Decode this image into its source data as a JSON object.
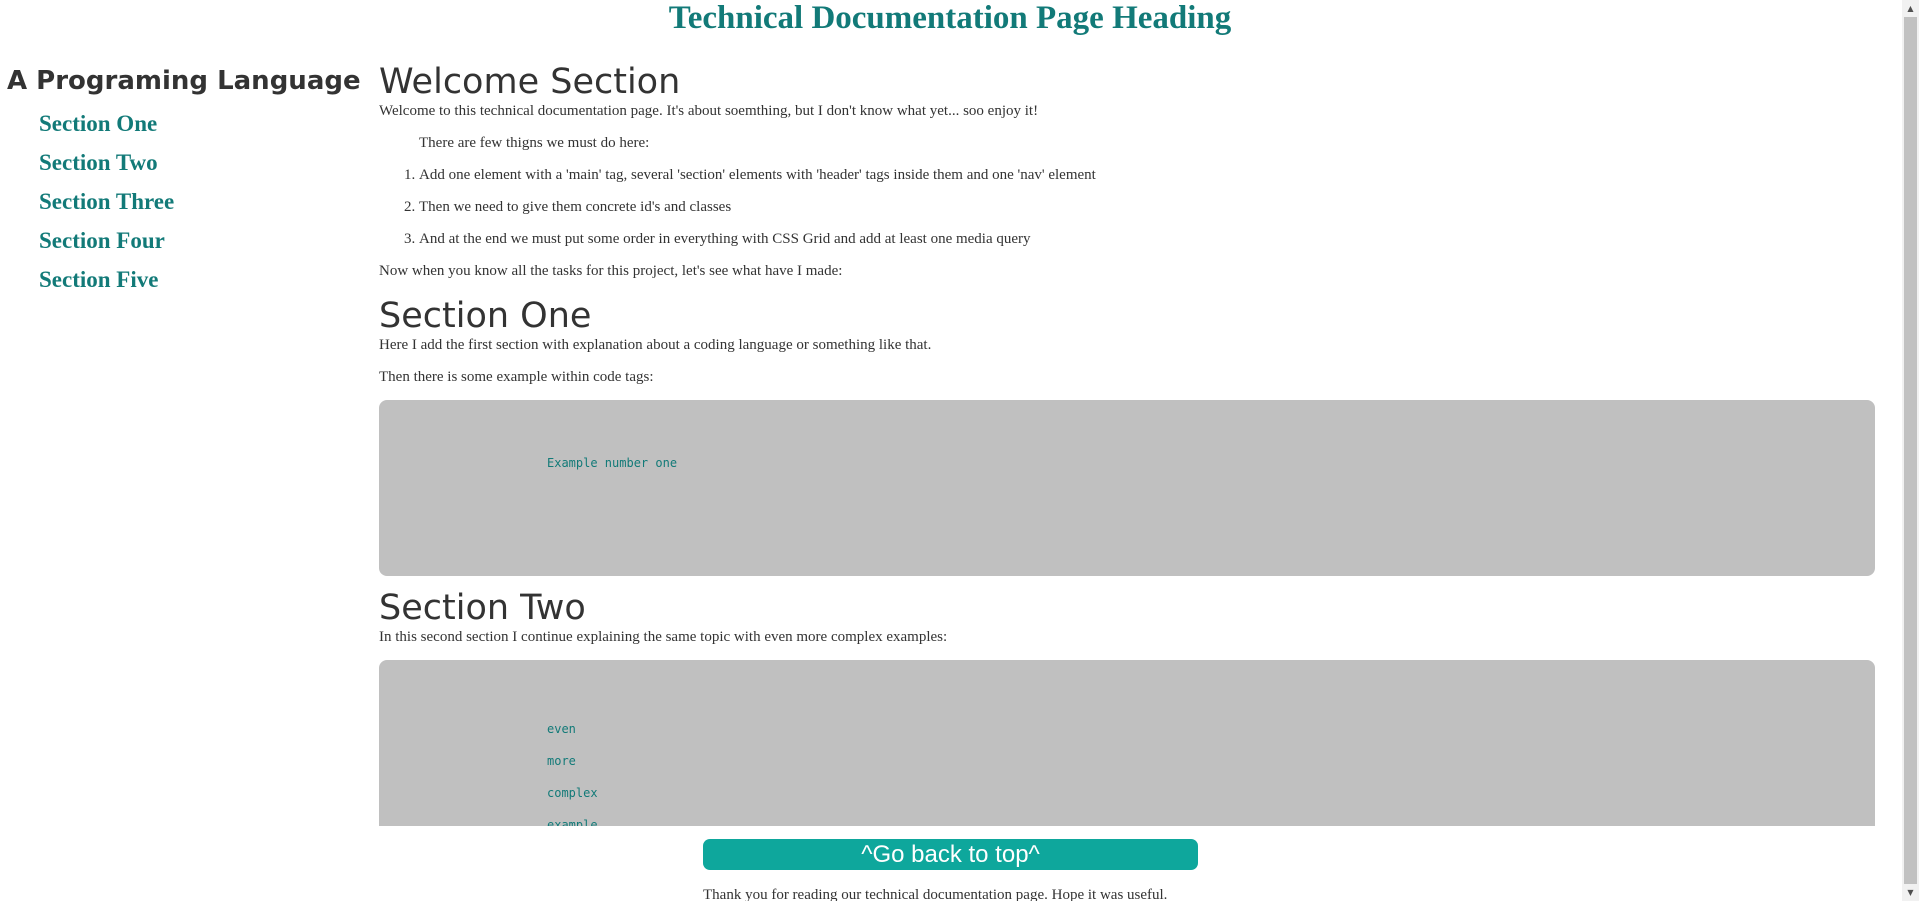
{
  "header": {
    "title": "Technical Documentation Page Heading"
  },
  "nav": {
    "header": "A Programing Language",
    "links": [
      {
        "label": "Section One"
      },
      {
        "label": "Section Two"
      },
      {
        "label": "Section Three"
      },
      {
        "label": "Section Four"
      },
      {
        "label": "Section Five"
      }
    ]
  },
  "main": {
    "welcome": {
      "title": "Welcome Section",
      "intro": "Welcome to this technical documentation page. It's about soemthing, but I don't know what yet... soo enjoy it!",
      "tasks_intro": "There are few thigns we must do here:",
      "tasks": [
        "Add one element with a 'main' tag, several 'section' elements with 'header' tags inside them and one 'nav' element",
        "Then we need to give them concrete id's and classes",
        "And at the end we must put some order in everything with CSS Grid and add at least one media query"
      ],
      "outro": "Now when you know all the tasks for this project, let's see what have I made:"
    },
    "section_one": {
      "title": "Section One",
      "p1": "Here I add the first section with explanation about a coding language or something like that.",
      "p2": "Then there is some example within code tags:",
      "code": [
        "Example number one"
      ]
    },
    "section_two": {
      "title": "Section Two",
      "p1": "In this second section I continue explaining the same topic with even more complex examples:",
      "code": [
        "even",
        "more",
        "complex",
        "example"
      ]
    }
  },
  "footer": {
    "button": "^Go back to top^",
    "text": "Thank you for reading our technical documentation page. Hope it was useful."
  },
  "colors": {
    "accent": "#127a78",
    "button": "#0ea79c",
    "code_bg": "#c0c0c0",
    "text": "#333333"
  }
}
